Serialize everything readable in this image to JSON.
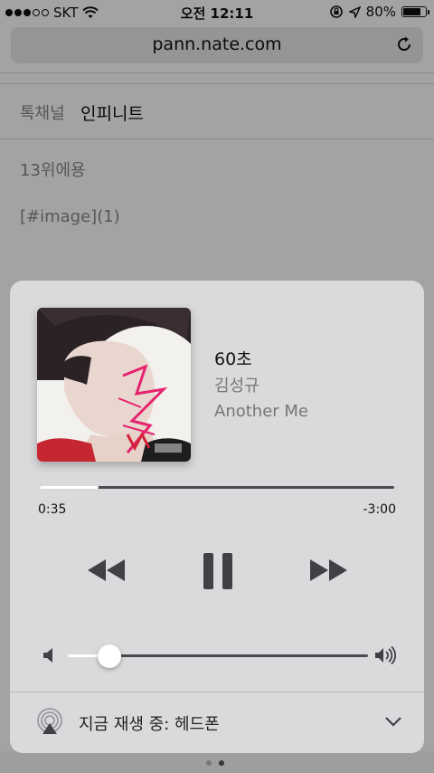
{
  "status_bar": {
    "carrier": "SKT",
    "time": "오전 12:11",
    "battery": "80%",
    "battery_level": 0.8,
    "signal_bars_filled": 3,
    "signal_bars_total": 5
  },
  "browser": {
    "url": "pann.nate.com"
  },
  "page": {
    "channel_label": "톡채널",
    "channel_name": "인피니트",
    "line1": "13위에용",
    "line2": "[#image](1)"
  },
  "now_playing": {
    "title": "60초",
    "artist": "김성규",
    "album": "Another Me",
    "elapsed": "0:35",
    "remaining": "-3:00",
    "progress": 0.166,
    "volume": 0.14,
    "output_label": "지금 재생 중: 헤드폰"
  },
  "icons": {
    "play_state": "pause-icon",
    "prev": "rewind-icon",
    "next": "fast-forward-icon",
    "airplay": "airplay-icon",
    "collapse": "chevron-down-icon"
  },
  "colors": {
    "panel_bg": "#dadadc",
    "control_dark": "#3f4146",
    "track_dark": "#4b4b4f"
  },
  "toolbar": {
    "page_count": 2,
    "active_page": 1
  }
}
